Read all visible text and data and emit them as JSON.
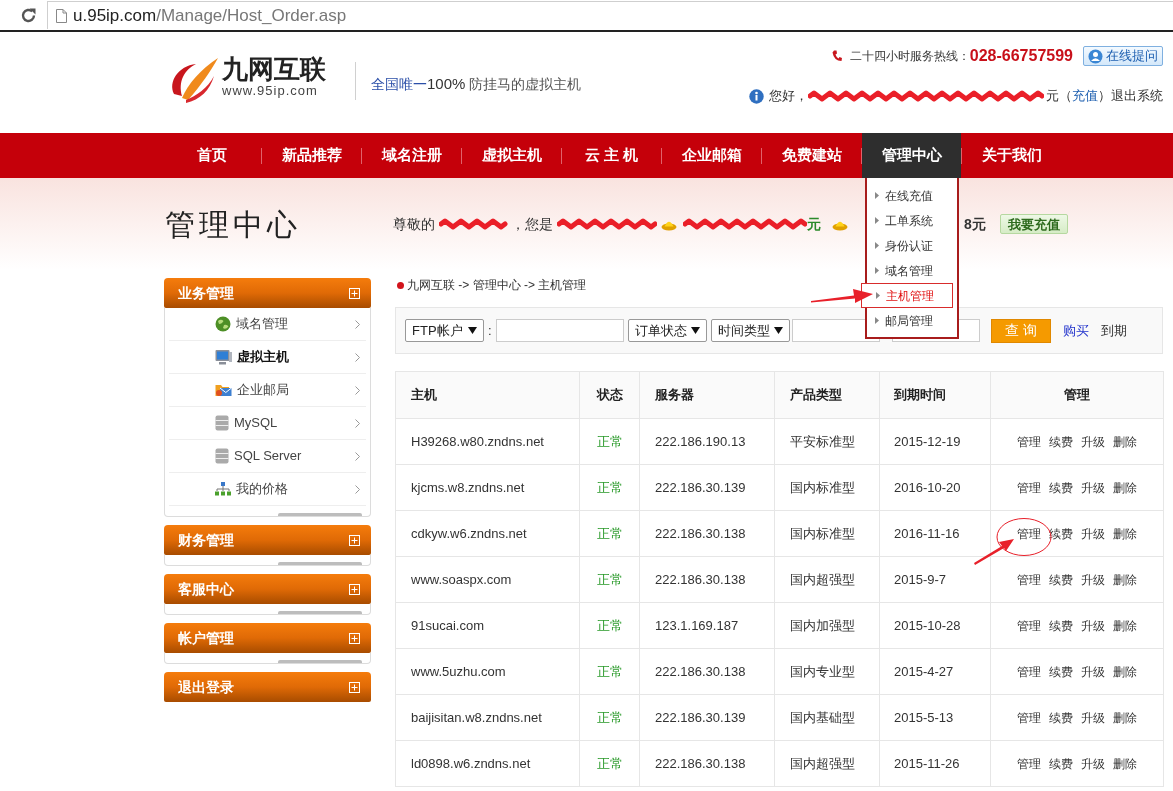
{
  "browser": {
    "url_host": "u.95ip.com",
    "url_path": "/Manage/Host_Order.asp"
  },
  "header": {
    "logo_name": "九网互联",
    "logo_domain": "www.95ip.com",
    "tagline_lead": "全国唯一",
    "tagline_figure": "100%",
    "tagline_rest": "防挂马的虚拟主机",
    "hotline_label": "二十四小时服务热线：",
    "hotline_number": "028-66757599",
    "ask_button": "在线提问",
    "greeting": "您好，",
    "balance_tail": "元（",
    "recharge_link": "充值",
    "paren_close": "）",
    "logout_link": "退出系统"
  },
  "nav": [
    {
      "label": "首页",
      "selected": false
    },
    {
      "label": "新品推荐",
      "selected": false
    },
    {
      "label": "域名注册",
      "selected": false
    },
    {
      "label": "虚拟主机",
      "selected": false
    },
    {
      "label": "云 主 机",
      "selected": false
    },
    {
      "label": "企业邮箱",
      "selected": false
    },
    {
      "label": "免费建站",
      "selected": false
    },
    {
      "label": "管理中心",
      "selected": true
    },
    {
      "label": "关于我们",
      "selected": false
    }
  ],
  "nav_dropdown": [
    {
      "label": "在线充值",
      "selected": false
    },
    {
      "label": "工单系统",
      "selected": false
    },
    {
      "label": "身份认证",
      "selected": false
    },
    {
      "label": "域名管理",
      "selected": false
    },
    {
      "label": "主机管理",
      "selected": true
    },
    {
      "label": "邮局管理",
      "selected": false
    }
  ],
  "page_title": "管理中心",
  "welcome": {
    "salutation": "尊敬的",
    "role_prefix": "，您是",
    "balance_unit": "元",
    "second_balance_tail": "8元",
    "recharge_button": "我要充值"
  },
  "sidebar": [
    {
      "title": "业务管理",
      "kind": "group",
      "items": [
        {
          "label": "域名管理",
          "kind": "domain",
          "selected": false
        },
        {
          "label": "虚拟主机",
          "kind": "hosting",
          "selected": true
        },
        {
          "label": "企业邮局",
          "kind": "mail",
          "selected": false
        },
        {
          "label": "MySQL",
          "kind": "mysql",
          "selected": false
        },
        {
          "label": "SQL Server",
          "kind": "sqlserver",
          "selected": false
        },
        {
          "label": "我的价格",
          "kind": "price",
          "selected": false
        }
      ]
    },
    {
      "title": "财务管理",
      "kind": "group"
    },
    {
      "title": "客服中心",
      "kind": "group"
    },
    {
      "title": "帐户管理",
      "kind": "group"
    },
    {
      "title": "退出登录",
      "kind": "action"
    }
  ],
  "breadcrumb": "九网互联 -> 管理中心 -> 主机管理",
  "filters": {
    "account_select": "FTP帐户",
    "separator": ":",
    "status_select": "订单状态",
    "time_select": "时间类型",
    "search_button": "查 询",
    "buy_link": "购买",
    "expiry_link": "到期"
  },
  "table": {
    "columns": [
      "主机",
      "状态",
      "服务器",
      "产品类型",
      "到期时间",
      "管理"
    ],
    "rows": [
      {
        "host": "H39268.w80.zndns.net",
        "status": "正常",
        "server": "222.186.190.13",
        "product": "平安标准型",
        "expires": "2015-12-19",
        "actions": [
          "管理",
          "续费",
          "升级",
          "删除"
        ]
      },
      {
        "host": "kjcms.w8.zndns.net",
        "status": "正常",
        "server": "222.186.30.139",
        "product": "国内标准型",
        "expires": "2016-10-20",
        "actions": [
          "管理",
          "续费",
          "升级",
          "删除"
        ]
      },
      {
        "host": "cdkyw.w6.zndns.net",
        "status": "正常",
        "server": "222.186.30.138",
        "product": "国内标准型",
        "expires": "2016-11-16",
        "actions": [
          "管理",
          "续费",
          "升级",
          "删除"
        ]
      },
      {
        "host": "www.soaspx.com",
        "status": "正常",
        "server": "222.186.30.138",
        "product": "国内超强型",
        "expires": "2015-9-7",
        "actions": [
          "管理",
          "续费",
          "升级",
          "删除"
        ]
      },
      {
        "host": "91sucai.com",
        "status": "正常",
        "server": "123.1.169.187",
        "product": "国内加强型",
        "expires": "2015-10-28",
        "actions": [
          "管理",
          "续费",
          "升级",
          "删除"
        ]
      },
      {
        "host": "www.5uzhu.com",
        "status": "正常",
        "server": "222.186.30.138",
        "product": "国内专业型",
        "expires": "2015-4-27",
        "actions": [
          "管理",
          "续费",
          "升级",
          "删除"
        ]
      },
      {
        "host": "baijisitan.w8.zndns.net",
        "status": "正常",
        "server": "222.186.30.139",
        "product": "国内基础型",
        "expires": "2015-5-13",
        "actions": [
          "管理",
          "续费",
          "升级",
          "删除"
        ]
      },
      {
        "host": "ld0898.w6.zndns.net",
        "status": "正常",
        "server": "222.186.30.138",
        "product": "国内超强型",
        "expires": "2015-11-26",
        "actions": [
          "管理",
          "续费",
          "升级",
          "删除"
        ]
      }
    ]
  }
}
